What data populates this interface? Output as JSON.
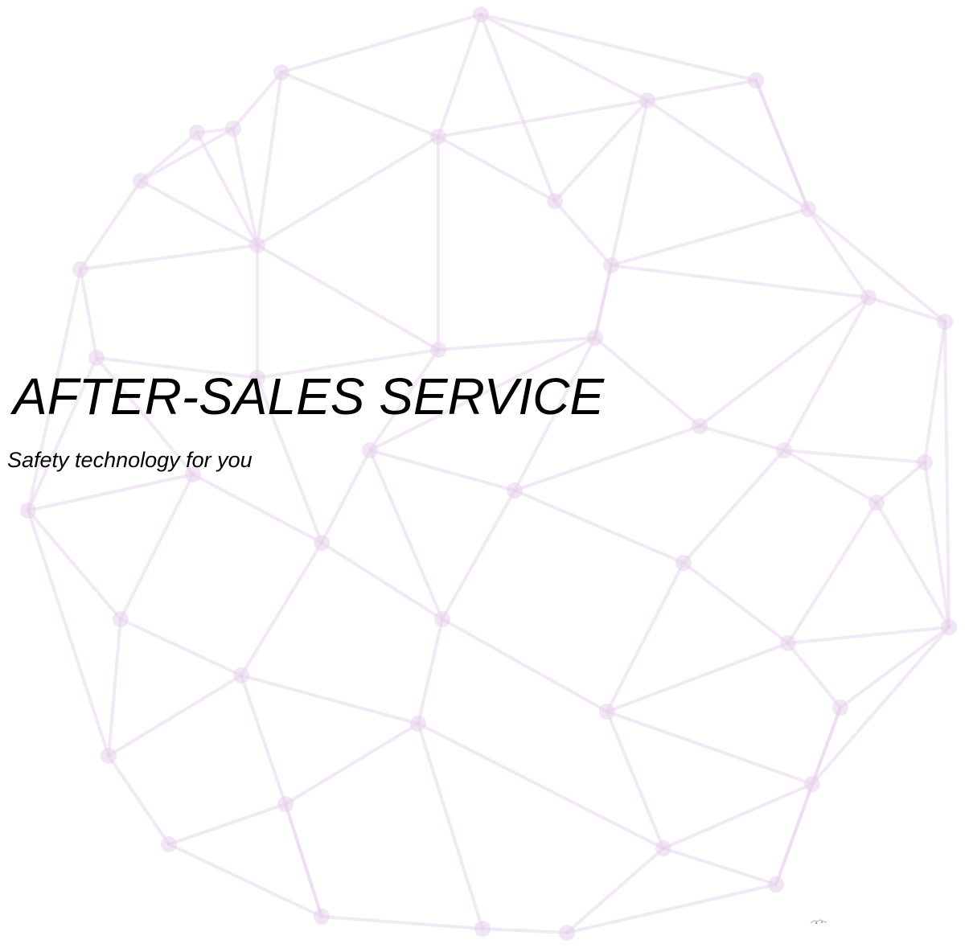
{
  "title": "AFTER-SALES SERVICE",
  "subtitle": "Safety technology for you",
  "background": {
    "icon": "geodesic-sphere-watermark",
    "line_color": "#ead6ec",
    "node_color": "#e6d1e9"
  },
  "text_color": "#000000"
}
